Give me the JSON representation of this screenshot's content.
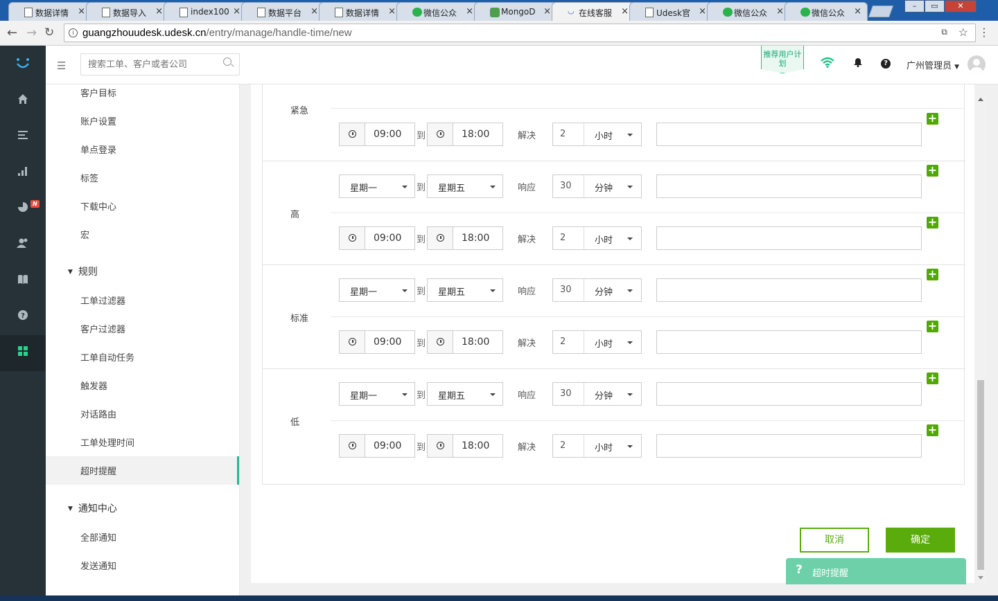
{
  "browser": {
    "tabs": [
      {
        "title": "数据详情",
        "icon": "page"
      },
      {
        "title": "数据导入",
        "icon": "page"
      },
      {
        "title": "index100",
        "icon": "page"
      },
      {
        "title": "数据平台",
        "icon": "page"
      },
      {
        "title": "数据详情",
        "icon": "page"
      },
      {
        "title": "微信公众",
        "icon": "wechat"
      },
      {
        "title": "MongoD",
        "icon": "mongodb"
      },
      {
        "title": "在线客服",
        "icon": "udesk"
      },
      {
        "title": "Udesk官",
        "icon": "page"
      },
      {
        "title": "微信公众",
        "icon": "wechat"
      },
      {
        "title": "微信公众",
        "icon": "wechat"
      }
    ],
    "active_tab": 7,
    "url_host": "guangzhouudesk.udesk.cn",
    "url_path": "/entry/manage/handle-time/new"
  },
  "header": {
    "search_placeholder": "搜索工单、客户或者公司",
    "recommend_label": "推荐用户计划",
    "user_name": "广州管理员",
    "help_symbol": "?"
  },
  "leftnav": {
    "items": [
      "home",
      "tickets",
      "reports",
      "analytics",
      "customers",
      "knowledge",
      "help",
      "apps"
    ],
    "badge": "N",
    "active": "apps"
  },
  "sidebar": {
    "items_top": [
      "客户目标",
      "账户设置",
      "单点登录",
      "标签",
      "下载中心",
      "宏"
    ],
    "group_rules": "规则",
    "rules_items": [
      "工单过滤器",
      "客户过滤器",
      "工单自动任务",
      "触发器",
      "对话路由",
      "工单处理时间",
      "超时提醒"
    ],
    "active_item": "超时提醒",
    "group_notify": "通知中心",
    "notify_items": [
      "全部通知",
      "发送通知"
    ]
  },
  "form": {
    "to_label": "到",
    "priorities": [
      {
        "name": "紧急",
        "rows": [
          {
            "type": "time",
            "start": "09:00",
            "end": "18:00",
            "action": "解决",
            "value": "2",
            "unit": "小时"
          }
        ]
      },
      {
        "name": "高",
        "rows": [
          {
            "type": "day",
            "start": "星期一",
            "end": "星期五",
            "action": "响应",
            "value": "30",
            "unit": "分钟"
          },
          {
            "type": "time",
            "start": "09:00",
            "end": "18:00",
            "action": "解决",
            "value": "2",
            "unit": "小时"
          }
        ]
      },
      {
        "name": "标准",
        "rows": [
          {
            "type": "day",
            "start": "星期一",
            "end": "星期五",
            "action": "响应",
            "value": "30",
            "unit": "分钟"
          },
          {
            "type": "time",
            "start": "09:00",
            "end": "18:00",
            "action": "解决",
            "value": "2",
            "unit": "小时"
          }
        ]
      },
      {
        "name": "低",
        "rows": [
          {
            "type": "day",
            "start": "星期一",
            "end": "星期五",
            "action": "响应",
            "value": "30",
            "unit": "分钟"
          },
          {
            "type": "time",
            "start": "09:00",
            "end": "18:00",
            "action": "解决",
            "value": "2",
            "unit": "小时"
          }
        ]
      }
    ],
    "cancel_label": "取消",
    "confirm_label": "确定"
  },
  "helptip": {
    "symbol": "?",
    "label": "超时提醒"
  },
  "colors": {
    "accent": "#5aac0d",
    "sidebar_dark": "#263238",
    "highlight": "#2bb594"
  }
}
